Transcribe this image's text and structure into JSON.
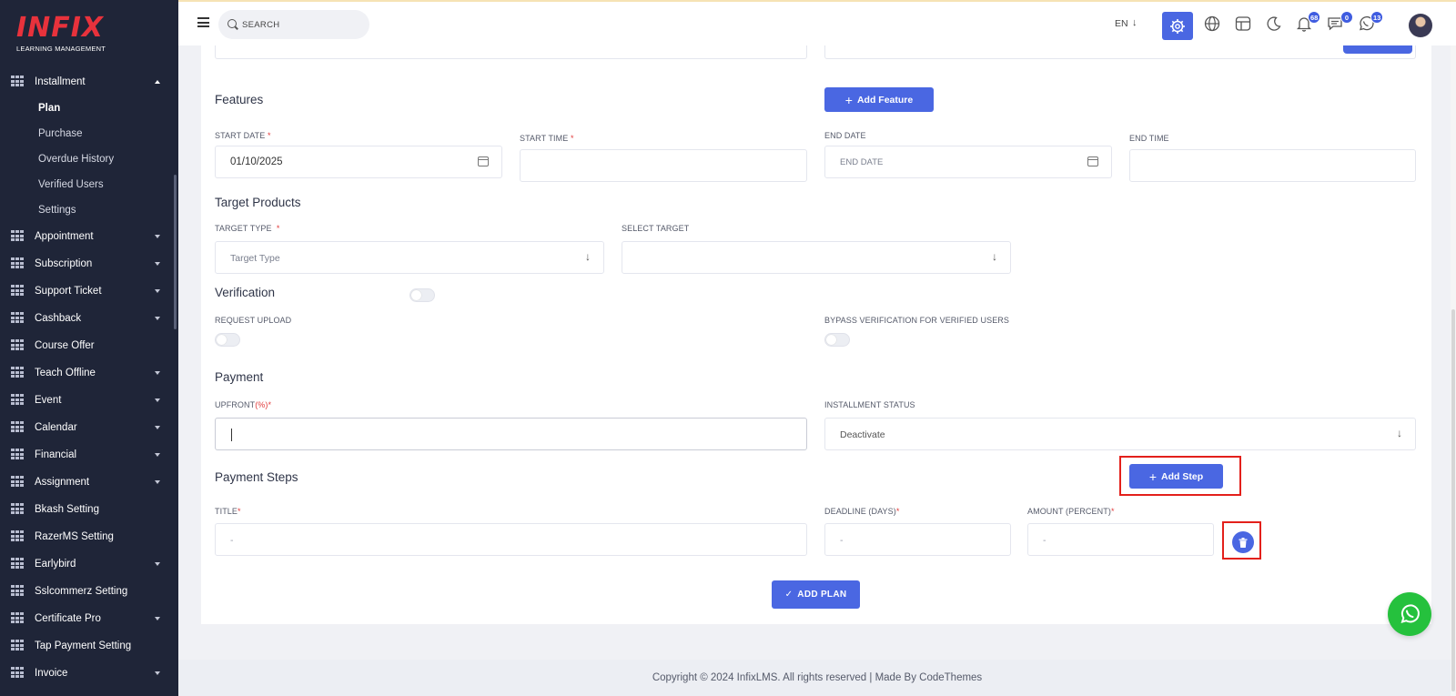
{
  "logo": {
    "brand": "INFIX",
    "tagline": "LEARNING MANAGEMENT"
  },
  "sidebar": {
    "installment": {
      "label": "Installment",
      "subitems": [
        "Plan",
        "Purchase",
        "Overdue History",
        "Verified Users",
        "Settings"
      ],
      "active_subitem": "Plan"
    },
    "items": [
      {
        "label": "Appointment",
        "has_caret": true
      },
      {
        "label": "Subscription",
        "has_caret": true
      },
      {
        "label": "Support Ticket",
        "has_caret": true
      },
      {
        "label": "Cashback",
        "has_caret": true
      },
      {
        "label": "Course Offer",
        "has_caret": false
      },
      {
        "label": "Teach Offline",
        "has_caret": true
      },
      {
        "label": "Event",
        "has_caret": true
      },
      {
        "label": "Calendar",
        "has_caret": true
      },
      {
        "label": "Financial",
        "has_caret": true
      },
      {
        "label": "Assignment",
        "has_caret": true
      },
      {
        "label": "Bkash Setting",
        "has_caret": false
      },
      {
        "label": "RazerMS Setting",
        "has_caret": false
      },
      {
        "label": "Earlybird",
        "has_caret": true
      },
      {
        "label": "Sslcommerz Setting",
        "has_caret": false
      },
      {
        "label": "Certificate Pro",
        "has_caret": true
      },
      {
        "label": "Tap Payment Setting",
        "has_caret": false
      },
      {
        "label": "Invoice",
        "has_caret": true
      }
    ]
  },
  "topbar": {
    "search_placeholder": "SEARCH",
    "language": "EN",
    "notifications_count": "68",
    "messages_count": "0",
    "whatsapp_count": "13"
  },
  "form": {
    "features": {
      "title": "Features",
      "add_button": "Add Feature"
    },
    "start_date": {
      "label": "START DATE",
      "value": "01/10/2025"
    },
    "start_time": {
      "label": "START TIME",
      "value": ""
    },
    "end_date": {
      "label": "END DATE",
      "placeholder": "END DATE"
    },
    "end_time": {
      "label": "END TIME",
      "value": ""
    },
    "target_products": {
      "title": "Target Products",
      "target_type_label": "TARGET TYPE",
      "target_type_placeholder": "Target Type",
      "select_target_label": "SELECT TARGET",
      "select_target_value": ""
    },
    "verification": {
      "title": "Verification",
      "request_upload_label": "REQUEST UPLOAD",
      "bypass_label": "BYPASS VERIFICATION FOR VERIFIED USERS"
    },
    "payment": {
      "title": "Payment",
      "upfront_label": "UPFRONT",
      "upfront_unit": "(%)",
      "upfront_value": "",
      "installment_status_label": "INSTALLMENT STATUS",
      "installment_status_value": "Deactivate"
    },
    "payment_steps": {
      "title": "Payment Steps",
      "add_step_button": "Add Step",
      "title_label": "TITLE",
      "deadline_label": "DEADLINE (DAYS)",
      "amount_label": "AMOUNT (PERCENT)",
      "title_placeholder": "-",
      "deadline_placeholder": "-",
      "amount_placeholder": "-"
    },
    "submit_button": "ADD PLAN"
  },
  "footer": {
    "copyright": "Copyright © 2024 InfixLMS. All rights reserved | Made By CodeThemes"
  },
  "colors": {
    "sidebar_bg": "#1f2538",
    "accent": "#4a67e2",
    "highlight_box": "#e3201b",
    "whatsapp": "#25c13d"
  }
}
